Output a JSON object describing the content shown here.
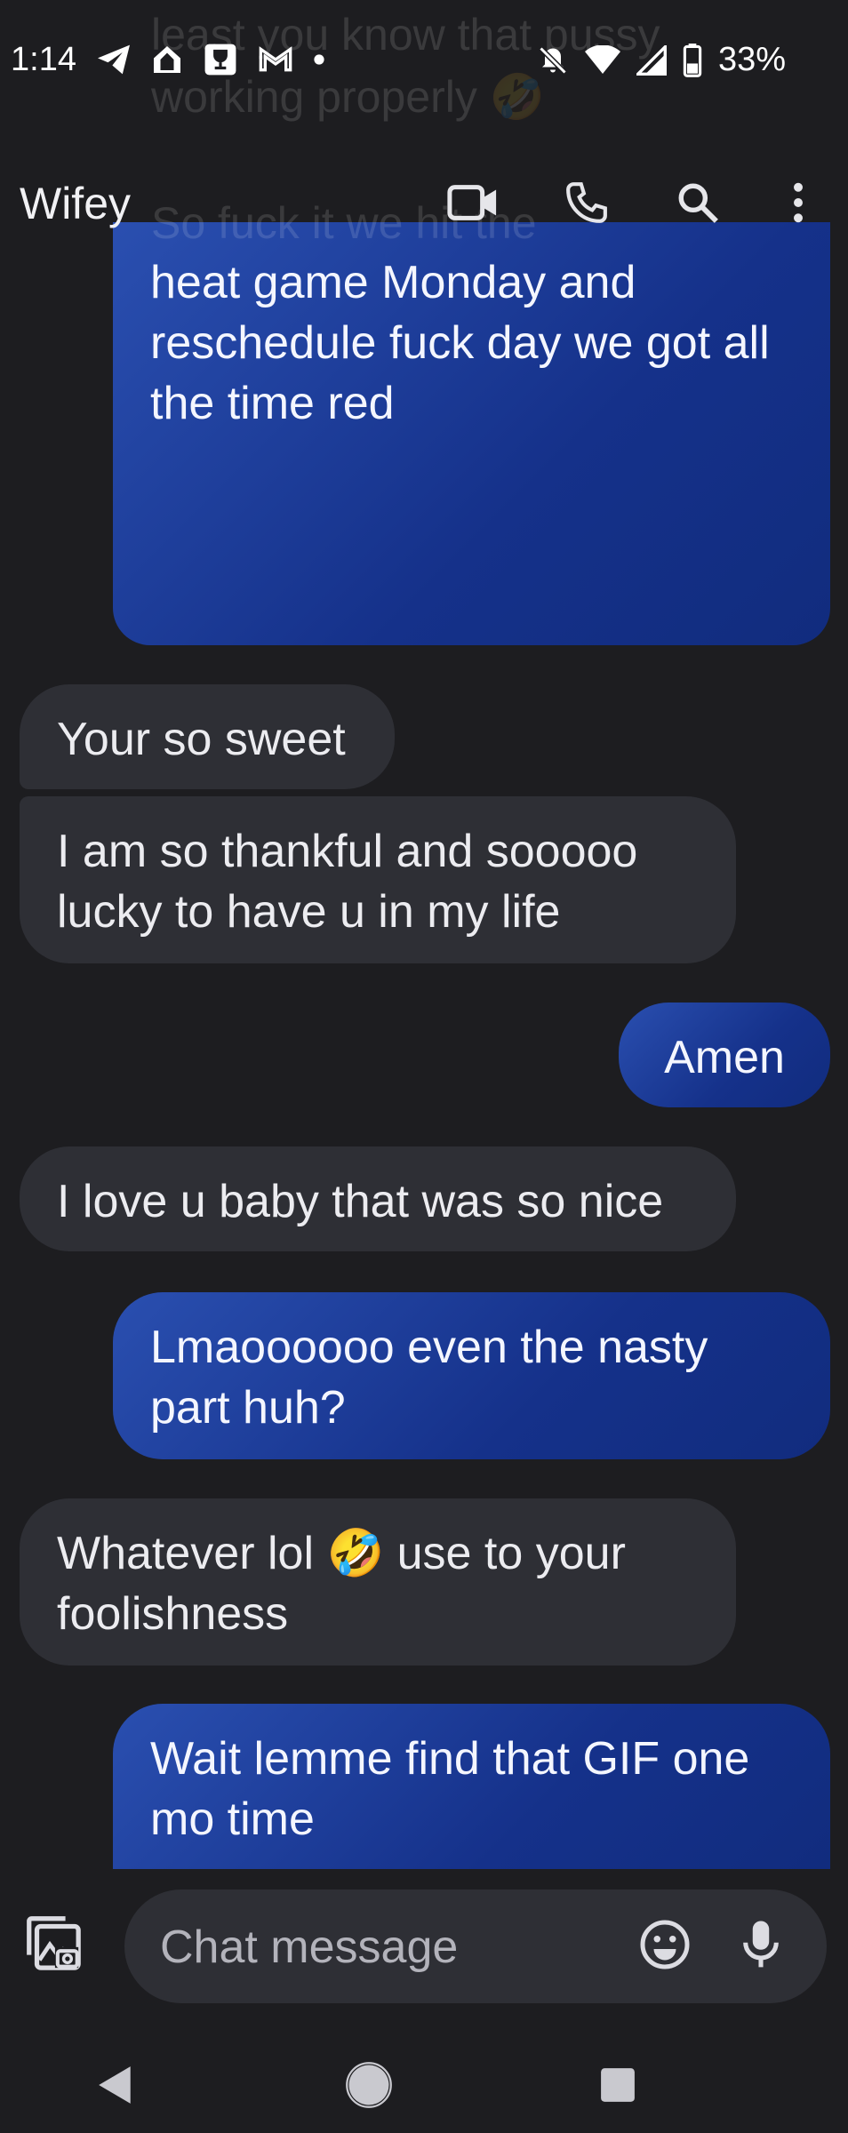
{
  "status_bar": {
    "time": "1:14",
    "battery": "33%",
    "icons_left": [
      "telegram-icon",
      "home-icon",
      "trophy-icon",
      "gmail-icon",
      "dot-icon"
    ],
    "icons_right": [
      "bell-off-icon",
      "wifi-icon",
      "signal-icon",
      "battery-icon"
    ]
  },
  "header": {
    "title": "Wifey",
    "ghost_lines": [
      "least you know that pussy",
      "working properly 🤣",
      "So fuck it we hit the"
    ],
    "actions": [
      "video-call-icon",
      "phone-icon",
      "search-icon",
      "more-vert-icon"
    ]
  },
  "messages": [
    {
      "direction": "outgoing",
      "text": "heat game Monday and reschedule fuck day we got all the time red"
    },
    {
      "direction": "incoming",
      "text": "Your so sweet"
    },
    {
      "direction": "incoming",
      "text": "I am so thankful and sooooo lucky to have u in my life"
    },
    {
      "direction": "outgoing",
      "text": "Amen"
    },
    {
      "direction": "incoming",
      "text": "I love u baby that was so nice"
    },
    {
      "direction": "outgoing",
      "text": "Lmaoooooo even the nasty part huh?"
    },
    {
      "direction": "incoming",
      "text": "Whatever lol 🤣 use to your foolishness"
    },
    {
      "direction": "outgoing",
      "text": "Wait lemme find that GIF one mo time"
    }
  ],
  "compose": {
    "placeholder": "Chat message",
    "icons": [
      "attach-media-icon",
      "emoji-icon",
      "mic-icon"
    ]
  },
  "colors": {
    "background": "#1d1d20",
    "incoming_bubble": "#2e2f35",
    "outgoing_bubble": "#1a3a9a"
  }
}
